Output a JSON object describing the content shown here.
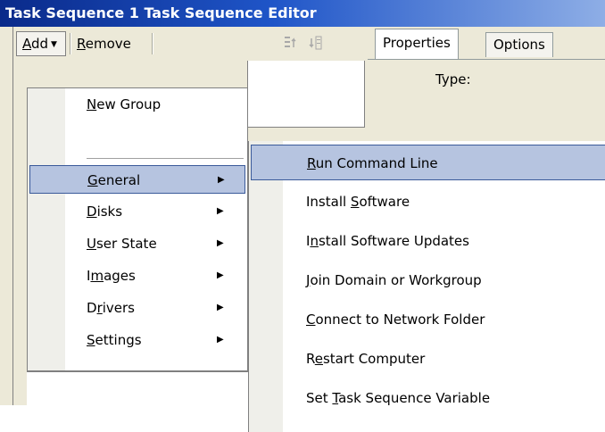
{
  "window": {
    "title": "Task Sequence 1 Task Sequence Editor"
  },
  "toolbar": {
    "add": {
      "hotkey": "A",
      "rest": "dd"
    },
    "remove": {
      "hotkey": "R",
      "rest": "emove"
    },
    "icons": [
      "move-up-icon",
      "move-down-icon"
    ]
  },
  "tabs": [
    {
      "label": "Properties",
      "active": true
    },
    {
      "label": "Options",
      "active": false
    }
  ],
  "properties": {
    "type_label": "Type:"
  },
  "add_menu": {
    "items": [
      {
        "pre": "",
        "hotkey": "N",
        "post": "ew Group",
        "submenu": false,
        "highlighted": false
      },
      {
        "pre": "",
        "hotkey": "G",
        "post": "eneral",
        "submenu": true,
        "highlighted": true
      },
      {
        "pre": "",
        "hotkey": "D",
        "post": "isks",
        "submenu": true,
        "highlighted": false
      },
      {
        "pre": "",
        "hotkey": "U",
        "post": "ser State",
        "submenu": true,
        "highlighted": false
      },
      {
        "pre": "I",
        "hotkey": "m",
        "post": "ages",
        "submenu": true,
        "highlighted": false
      },
      {
        "pre": "D",
        "hotkey": "r",
        "post": "ivers",
        "submenu": true,
        "highlighted": false
      },
      {
        "pre": "",
        "hotkey": "S",
        "post": "ettings",
        "submenu": true,
        "highlighted": false
      }
    ]
  },
  "general_submenu": {
    "items": [
      {
        "pre": "",
        "hotkey": "R",
        "post": "un Command Line",
        "highlighted": true
      },
      {
        "pre": "Install ",
        "hotkey": "S",
        "post": "oftware",
        "highlighted": false
      },
      {
        "pre": "I",
        "hotkey": "n",
        "post": "stall Software Updates",
        "highlighted": false
      },
      {
        "pre": "",
        "hotkey": "J",
        "post": "oin Domain or Workgroup",
        "highlighted": false
      },
      {
        "pre": "",
        "hotkey": "C",
        "post": "onnect to Network Folder",
        "highlighted": false
      },
      {
        "pre": "R",
        "hotkey": "e",
        "post": "start Computer",
        "highlighted": false
      },
      {
        "pre": "Set ",
        "hotkey": "T",
        "post": "ask Sequence Variable",
        "highlighted": false
      }
    ]
  },
  "colors": {
    "title_start": "#0a2a8a",
    "title_end": "#8eaee6",
    "highlight": "#b6c4e0",
    "highlight_border": "#3a5a9a",
    "window_bg": "#ece9d8"
  }
}
